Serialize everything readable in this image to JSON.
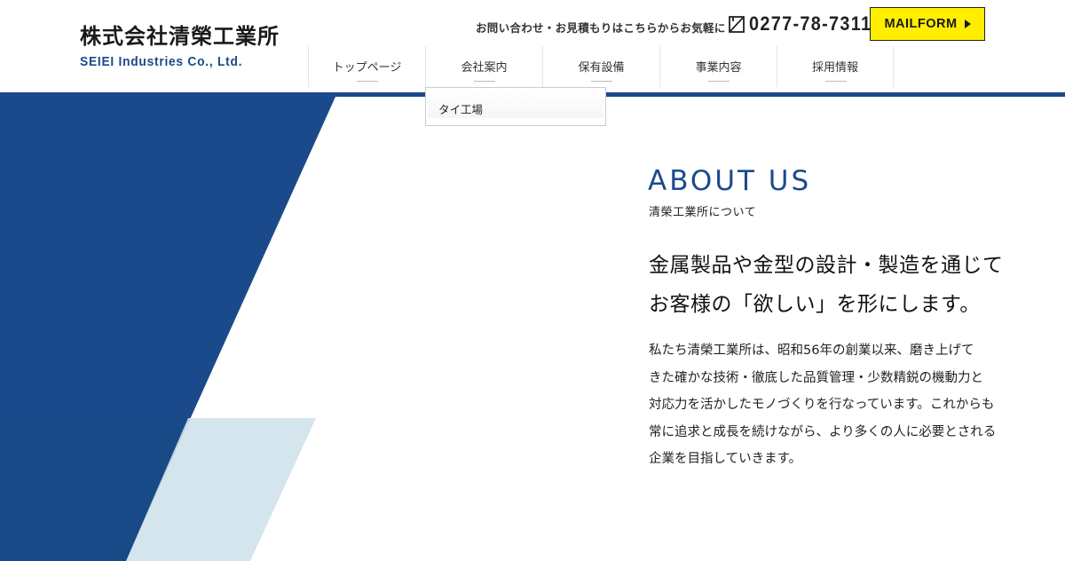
{
  "header": {
    "logo_ja": "株式会社清榮工業所",
    "logo_en": "SEIEI Industries Co., Ltd.",
    "contact_text": "お問い合わせ・お見積もりはこちらからお気軽に",
    "phone": "0277-78-7311",
    "mail_button": "MAILFORM",
    "phone_icon": "phone-icon",
    "arrow_icon": "triangle-right-icon"
  },
  "nav": {
    "items": [
      {
        "label": "トップページ"
      },
      {
        "label": "会社案内"
      },
      {
        "label": "保有設備"
      },
      {
        "label": "事業内容"
      },
      {
        "label": "採用情報"
      }
    ],
    "dropdown": {
      "items": [
        {
          "label": "タイ工場"
        }
      ]
    }
  },
  "about": {
    "title": "ABOUT US",
    "subtitle": "清榮工業所について",
    "headline": [
      "金属製品や金型の設計・製造を通じて",
      "お客様の「欲しい」を形にします。"
    ],
    "body": [
      "私たち清榮工業所は、昭和56年の創業以来、磨き上げて",
      "きた確かな技術・徹底した品質管理・少数精鋭の機動力と",
      "対応力を活かしたモノづくりを行なっています。これからも",
      "常に追求と成長を続けながら、より多くの人に必要とされる",
      "企業を目指していきます。"
    ]
  },
  "colors": {
    "brand_blue": "#1b4a8c",
    "light_blue": "#cfe2ec",
    "button_yellow": "#ffee00"
  }
}
